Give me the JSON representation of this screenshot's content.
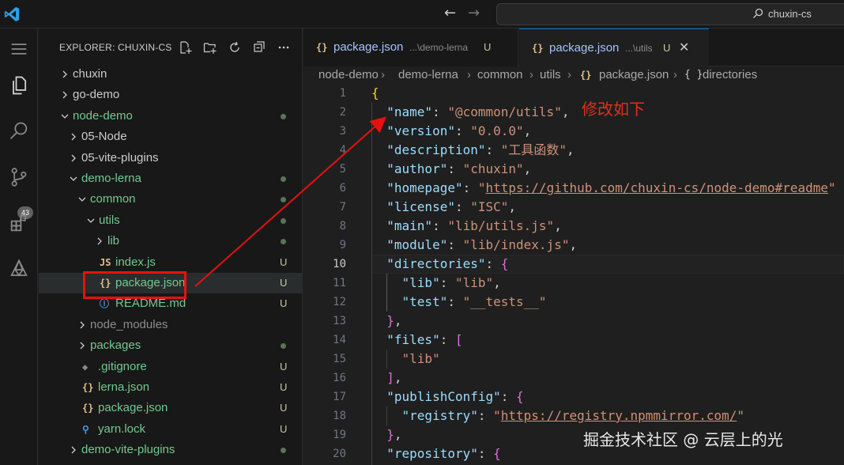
{
  "titlebar": {
    "search_text": "chuxin-cs",
    "logo_icon": "vscode-logo-icon",
    "back_icon": "arrow-left-icon",
    "forward_icon": "arrow-right-icon"
  },
  "activity": {
    "scm_badge": "43"
  },
  "sidebar": {
    "title": "EXPLORER: CHUXIN-CS",
    "tree": [
      {
        "label": "chuxin",
        "kind": "folder",
        "state": "collapsed",
        "mark": ""
      },
      {
        "label": "go-demo",
        "kind": "folder",
        "state": "collapsed",
        "mark": ""
      },
      {
        "label": "node-demo",
        "kind": "folder",
        "state": "expanded",
        "mark": "dot"
      },
      {
        "label": "05-Node",
        "kind": "folder",
        "state": "collapsed",
        "mark": ""
      },
      {
        "label": "05-vite-plugins",
        "kind": "folder",
        "state": "collapsed",
        "mark": ""
      },
      {
        "label": "demo-lerna",
        "kind": "folder",
        "state": "expanded",
        "mark": "dot"
      },
      {
        "label": "common",
        "kind": "folder",
        "state": "expanded",
        "mark": "dot"
      },
      {
        "label": "utils",
        "kind": "folder",
        "state": "expanded",
        "mark": "dot"
      },
      {
        "label": "lib",
        "kind": "folder",
        "state": "collapsed",
        "mark": "dot"
      },
      {
        "label": "index.js",
        "kind": "js",
        "icon_text": "JS",
        "mark": "U"
      },
      {
        "label": "package.json",
        "kind": "json",
        "icon_text": "{}",
        "mark": "U"
      },
      {
        "label": "README.md",
        "kind": "info",
        "icon_text": "ⓘ",
        "mark": "U"
      },
      {
        "label": "node_modules",
        "kind": "folder",
        "state": "collapsed",
        "mark": ""
      },
      {
        "label": "packages",
        "kind": "folder",
        "state": "collapsed",
        "mark": "dot"
      },
      {
        "label": ".gitignore",
        "kind": "git",
        "icon_text": "◆",
        "mark": "U"
      },
      {
        "label": "lerna.json",
        "kind": "json",
        "icon_text": "{}",
        "mark": "U"
      },
      {
        "label": "package.json",
        "kind": "json",
        "icon_text": "{}",
        "mark": "U"
      },
      {
        "label": "yarn.lock",
        "kind": "yarn",
        "icon_text": "⚲",
        "mark": "U"
      },
      {
        "label": "demo-vite-plugins",
        "kind": "folder",
        "state": "collapsed",
        "mark": "dot"
      }
    ]
  },
  "tabs": [
    {
      "icon": "{}",
      "name": "package.json",
      "desc": "...\\demo-lerna",
      "mark": "U"
    },
    {
      "icon": "{}",
      "name": "package.json",
      "desc": "...\\utils",
      "mark": "U",
      "close": "✕"
    }
  ],
  "breadcrumb": {
    "items": [
      "node-demo",
      "demo-lerna",
      "common",
      "utils",
      "package.json",
      "directories"
    ],
    "file_icon": "{}",
    "symbol_icon": "{ }"
  },
  "editor": {
    "active_line": 10,
    "line_numbers": [
      "1",
      "2",
      "3",
      "4",
      "5",
      "6",
      "7",
      "8",
      "9",
      "10",
      "11",
      "12",
      "13",
      "14",
      "15",
      "16",
      "17",
      "18",
      "19",
      "20"
    ],
    "lines": [
      [
        [
          "b1",
          "{"
        ]
      ],
      [
        [
          "p",
          "  "
        ],
        [
          "k",
          "\"name\""
        ],
        [
          "p",
          ": "
        ],
        [
          "s",
          "\"@common/utils\""
        ],
        [
          "p",
          ","
        ]
      ],
      [
        [
          "p",
          "  "
        ],
        [
          "k",
          "\"version\""
        ],
        [
          "p",
          ": "
        ],
        [
          "s",
          "\"0.0.0\""
        ],
        [
          "p",
          ","
        ]
      ],
      [
        [
          "p",
          "  "
        ],
        [
          "k",
          "\"description\""
        ],
        [
          "p",
          ": "
        ],
        [
          "s",
          "\"工具函数\""
        ],
        [
          "p",
          ","
        ]
      ],
      [
        [
          "p",
          "  "
        ],
        [
          "k",
          "\"author\""
        ],
        [
          "p",
          ": "
        ],
        [
          "s",
          "\"chuxin\""
        ],
        [
          "p",
          ","
        ]
      ],
      [
        [
          "p",
          "  "
        ],
        [
          "k",
          "\"homepage\""
        ],
        [
          "p",
          ": "
        ],
        [
          "s",
          "\""
        ],
        [
          "url",
          "https://github.com/chuxin-cs/node-demo#readme"
        ],
        [
          "s",
          "\""
        ]
      ],
      [
        [
          "p",
          "  "
        ],
        [
          "k",
          "\"license\""
        ],
        [
          "p",
          ": "
        ],
        [
          "s",
          "\"ISC\""
        ],
        [
          "p",
          ","
        ]
      ],
      [
        [
          "p",
          "  "
        ],
        [
          "k",
          "\"main\""
        ],
        [
          "p",
          ": "
        ],
        [
          "s",
          "\"lib/utils.js\""
        ],
        [
          "p",
          ","
        ]
      ],
      [
        [
          "p",
          "  "
        ],
        [
          "k",
          "\"module\""
        ],
        [
          "p",
          ": "
        ],
        [
          "s",
          "\"lib/index.js\""
        ],
        [
          "p",
          ","
        ]
      ],
      [
        [
          "p",
          "  "
        ],
        [
          "k",
          "\"directories\""
        ],
        [
          "p",
          ": "
        ],
        [
          "b2",
          "{"
        ]
      ],
      [
        [
          "p",
          "    "
        ],
        [
          "k",
          "\"lib\""
        ],
        [
          "p",
          ": "
        ],
        [
          "s",
          "\"lib\""
        ],
        [
          "p",
          ","
        ]
      ],
      [
        [
          "p",
          "    "
        ],
        [
          "k",
          "\"test\""
        ],
        [
          "p",
          ": "
        ],
        [
          "s",
          "\"__tests__\""
        ]
      ],
      [
        [
          "p",
          "  "
        ],
        [
          "b2",
          "}"
        ],
        [
          "p",
          ","
        ]
      ],
      [
        [
          "p",
          "  "
        ],
        [
          "k",
          "\"files\""
        ],
        [
          "p",
          ": "
        ],
        [
          "b2",
          "["
        ]
      ],
      [
        [
          "p",
          "    "
        ],
        [
          "s",
          "\"lib\""
        ]
      ],
      [
        [
          "p",
          "  "
        ],
        [
          "b2",
          "]"
        ],
        [
          "p",
          ","
        ]
      ],
      [
        [
          "p",
          "  "
        ],
        [
          "k",
          "\"publishConfig\""
        ],
        [
          "p",
          ": "
        ],
        [
          "b2",
          "{"
        ]
      ],
      [
        [
          "p",
          "    "
        ],
        [
          "k",
          "\"registry\""
        ],
        [
          "p",
          ": "
        ],
        [
          "s",
          "\""
        ],
        [
          "url",
          "https://registry.npmmirror.com/"
        ],
        [
          "s",
          "\""
        ]
      ],
      [
        [
          "p",
          "  "
        ],
        [
          "b2",
          "}"
        ],
        [
          "p",
          ","
        ]
      ],
      [
        [
          "p",
          "  "
        ],
        [
          "k",
          "\"repository\""
        ],
        [
          "p",
          ": "
        ],
        [
          "b2",
          "{"
        ]
      ]
    ]
  },
  "annotation": {
    "text": "修改如下",
    "color": "#e81010"
  },
  "watermark": "掘金技术社区 @ 云层上的光"
}
